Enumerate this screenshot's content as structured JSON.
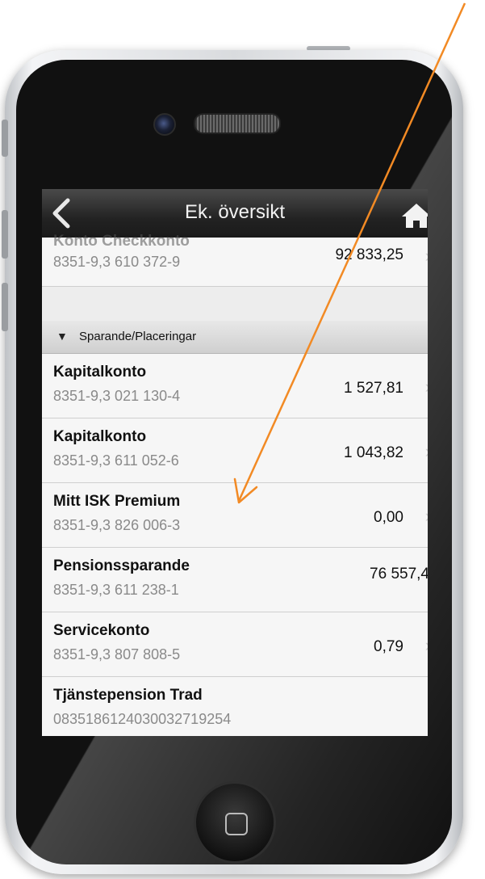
{
  "nav": {
    "title": "Ek. översikt"
  },
  "top_account": {
    "name": "Konto Checkkonto",
    "number": "8351-9,3 610 372-9",
    "amount": "92 833,25"
  },
  "section": {
    "label": "Sparande/Placeringar"
  },
  "accounts": [
    {
      "name": "Kapitalkonto",
      "number": "8351-9,3 021 130-4",
      "amount": "1 527,81"
    },
    {
      "name": "Kapitalkonto",
      "number": "8351-9,3 611 052-6",
      "amount": "1 043,82"
    },
    {
      "name": "Mitt ISK Premium",
      "number": "8351-9,3 826 006-3",
      "amount": "0,00"
    },
    {
      "name": "Pensionssparande",
      "number": "8351-9,3 611 238-1",
      "amount": "76 557,4"
    },
    {
      "name": "Servicekonto",
      "number": "8351-9,3 807 808-5",
      "amount": "0,79"
    },
    {
      "name": "Tjänstepension Trad",
      "number": "0835186124030032719254",
      "amount": ""
    }
  ],
  "colors": {
    "accent": "#f17a10",
    "annotation_arrow": "#f28a24"
  },
  "icons": [
    "back-chevron-icon",
    "home-icon",
    "disclosure-triangle-icon",
    "chevron-right-icon"
  ]
}
